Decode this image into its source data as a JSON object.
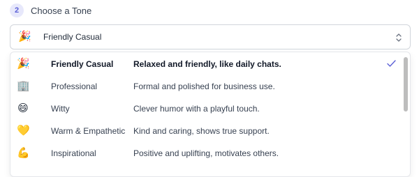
{
  "step": {
    "number": "2",
    "title": "Choose a Tone"
  },
  "select": {
    "selected_emoji": "🎉",
    "selected_label": "Friendly Casual",
    "chevron_icon": "chevron-up-down-icon"
  },
  "options": [
    {
      "emoji": "🎉",
      "name": "Friendly Casual",
      "description": "Relaxed and friendly, like daily chats.",
      "selected": true
    },
    {
      "emoji": "🏢",
      "name": "Professional",
      "description": "Formal and polished for business use.",
      "selected": false
    },
    {
      "emoji": "😄",
      "name": "Witty",
      "description": "Clever humor with a playful touch.",
      "selected": false
    },
    {
      "emoji": "💛",
      "name": "Warm & Empathetic",
      "description": "Kind and caring, shows true support.",
      "selected": false
    },
    {
      "emoji": "💪",
      "name": "Inspirational",
      "description": "Positive and uplifting, motivates others.",
      "selected": false
    }
  ],
  "colors": {
    "accent": "#5b5fd6",
    "badge_bg": "#e7e8fb",
    "border": "#d1d5db",
    "text": "#374151",
    "scrollbar": "#bdbdbd"
  }
}
